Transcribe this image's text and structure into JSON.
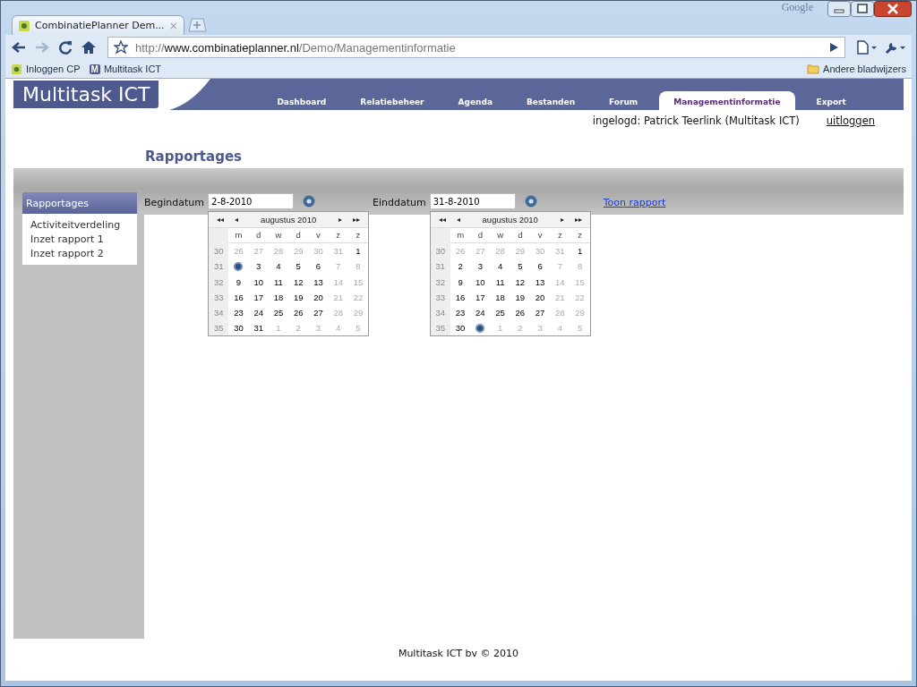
{
  "browser": {
    "tab_title": "CombinatiePlanner Dem...",
    "tab_close": "×",
    "brand": "Google",
    "url_prefix": "http://",
    "url_host": "www.combinatieplanner.nl",
    "url_path": "/Demo/Managementinformatie",
    "bookmarks": [
      {
        "label": "Inloggen CP",
        "kind": "cp"
      },
      {
        "label": "Multitask ICT",
        "kind": "m",
        "letter": "M"
      }
    ],
    "other_bookmarks": "Andere bladwijzers"
  },
  "site": {
    "logo": "Multitask ICT",
    "nav": [
      {
        "label": "Dashboard",
        "selected": false
      },
      {
        "label": "Relatiebeheer",
        "selected": false
      },
      {
        "label": "Agenda",
        "selected": false
      },
      {
        "label": "Bestanden",
        "selected": false
      },
      {
        "label": "Forum",
        "selected": false
      },
      {
        "label": "Managementinformatie",
        "selected": true
      },
      {
        "label": "Export",
        "selected": false
      }
    ],
    "login_text": "ingelogd: Patrick Teerlink (Multitask ICT)",
    "logout": "uitloggen",
    "page_title": "Rapportages"
  },
  "sidebar": {
    "title": "Rapportages",
    "items": [
      "Activiteitverdeling",
      "Inzet rapport 1",
      "Inzet rapport 2"
    ]
  },
  "filter": {
    "begin_label": "Begindatum",
    "begin_value": "2-8-2010",
    "end_label": "Einddatum",
    "end_value": "31-8-2010",
    "link": "Toon rapport"
  },
  "calendars": [
    {
      "nav": [
        "◂◂",
        "◂",
        "▸",
        "▸▸"
      ],
      "month": "augustus 2010",
      "weekdays": [
        "m",
        "d",
        "w",
        "d",
        "v",
        "z",
        "z"
      ],
      "weeks": [
        {
          "week": "30",
          "days": [
            {
              "label": "26",
              "muted": true,
              "selected": false
            },
            {
              "label": "27",
              "muted": true,
              "selected": false
            },
            {
              "label": "28",
              "muted": true,
              "selected": false
            },
            {
              "label": "29",
              "muted": true,
              "selected": false
            },
            {
              "label": "30",
              "muted": true,
              "selected": false
            },
            {
              "label": "31",
              "muted": true,
              "selected": false
            },
            {
              "label": "1",
              "muted": false,
              "selected": false
            }
          ]
        },
        {
          "week": "31",
          "days": [
            {
              "muted": false,
              "selected": true
            },
            {
              "label": "3",
              "muted": false,
              "selected": false
            },
            {
              "label": "4",
              "muted": false,
              "selected": false
            },
            {
              "label": "5",
              "muted": false,
              "selected": false
            },
            {
              "label": "6",
              "muted": false,
              "selected": false
            },
            {
              "label": "7",
              "muted": true,
              "selected": false
            },
            {
              "label": "8",
              "muted": true,
              "selected": false
            }
          ]
        },
        {
          "week": "32",
          "days": [
            {
              "label": "9",
              "muted": false,
              "selected": false
            },
            {
              "label": "10",
              "muted": false,
              "selected": false
            },
            {
              "label": "11",
              "muted": false,
              "selected": false
            },
            {
              "label": "12",
              "muted": false,
              "selected": false
            },
            {
              "label": "13",
              "muted": false,
              "selected": false
            },
            {
              "label": "14",
              "muted": true,
              "selected": false
            },
            {
              "label": "15",
              "muted": true,
              "selected": false
            }
          ]
        },
        {
          "week": "33",
          "days": [
            {
              "label": "16",
              "muted": false,
              "selected": false
            },
            {
              "label": "17",
              "muted": false,
              "selected": false
            },
            {
              "label": "18",
              "muted": false,
              "selected": false
            },
            {
              "label": "19",
              "muted": false,
              "selected": false
            },
            {
              "label": "20",
              "muted": false,
              "selected": false
            },
            {
              "label": "21",
              "muted": true,
              "selected": false
            },
            {
              "label": "22",
              "muted": true,
              "selected": false
            }
          ]
        },
        {
          "week": "34",
          "days": [
            {
              "label": "23",
              "muted": false,
              "selected": false
            },
            {
              "label": "24",
              "muted": false,
              "selected": false
            },
            {
              "label": "25",
              "muted": false,
              "selected": false
            },
            {
              "label": "26",
              "muted": false,
              "selected": false
            },
            {
              "label": "27",
              "muted": false,
              "selected": false
            },
            {
              "label": "28",
              "muted": true,
              "selected": false
            },
            {
              "label": "29",
              "muted": true,
              "selected": false
            }
          ]
        },
        {
          "week": "35",
          "days": [
            {
              "label": "30",
              "muted": false,
              "selected": false
            },
            {
              "label": "31",
              "muted": false,
              "selected": false
            },
            {
              "label": "1",
              "muted": true,
              "selected": false
            },
            {
              "label": "2",
              "muted": true,
              "selected": false
            },
            {
              "label": "3",
              "muted": true,
              "selected": false
            },
            {
              "label": "4",
              "muted": true,
              "selected": false
            },
            {
              "label": "5",
              "muted": true,
              "selected": false
            }
          ]
        }
      ]
    },
    {
      "nav": [
        "◂◂",
        "◂",
        "▸",
        "▸▸"
      ],
      "month": "augustus 2010",
      "weekdays": [
        "m",
        "d",
        "w",
        "d",
        "v",
        "z",
        "z"
      ],
      "weeks": [
        {
          "week": "30",
          "days": [
            {
              "label": "26",
              "muted": true,
              "selected": false
            },
            {
              "label": "27",
              "muted": true,
              "selected": false
            },
            {
              "label": "28",
              "muted": true,
              "selected": false
            },
            {
              "label": "29",
              "muted": true,
              "selected": false
            },
            {
              "label": "30",
              "muted": true,
              "selected": false
            },
            {
              "label": "31",
              "muted": true,
              "selected": false
            },
            {
              "label": "1",
              "muted": false,
              "selected": false
            }
          ]
        },
        {
          "week": "31",
          "days": [
            {
              "label": "2",
              "muted": false,
              "selected": false
            },
            {
              "label": "3",
              "muted": false,
              "selected": false
            },
            {
              "label": "4",
              "muted": false,
              "selected": false
            },
            {
              "label": "5",
              "muted": false,
              "selected": false
            },
            {
              "label": "6",
              "muted": false,
              "selected": false
            },
            {
              "label": "7",
              "muted": true,
              "selected": false
            },
            {
              "label": "8",
              "muted": true,
              "selected": false
            }
          ]
        },
        {
          "week": "32",
          "days": [
            {
              "label": "9",
              "muted": false,
              "selected": false
            },
            {
              "label": "10",
              "muted": false,
              "selected": false
            },
            {
              "label": "11",
              "muted": false,
              "selected": false
            },
            {
              "label": "12",
              "muted": false,
              "selected": false
            },
            {
              "label": "13",
              "muted": false,
              "selected": false
            },
            {
              "label": "14",
              "muted": true,
              "selected": false
            },
            {
              "label": "15",
              "muted": true,
              "selected": false
            }
          ]
        },
        {
          "week": "33",
          "days": [
            {
              "label": "16",
              "muted": false,
              "selected": false
            },
            {
              "label": "17",
              "muted": false,
              "selected": false
            },
            {
              "label": "18",
              "muted": false,
              "selected": false
            },
            {
              "label": "19",
              "muted": false,
              "selected": false
            },
            {
              "label": "20",
              "muted": false,
              "selected": false
            },
            {
              "label": "21",
              "muted": true,
              "selected": false
            },
            {
              "label": "22",
              "muted": true,
              "selected": false
            }
          ]
        },
        {
          "week": "34",
          "days": [
            {
              "label": "23",
              "muted": false,
              "selected": false
            },
            {
              "label": "24",
              "muted": false,
              "selected": false
            },
            {
              "label": "25",
              "muted": false,
              "selected": false
            },
            {
              "label": "26",
              "muted": false,
              "selected": false
            },
            {
              "label": "27",
              "muted": false,
              "selected": false
            },
            {
              "label": "28",
              "muted": true,
              "selected": false
            },
            {
              "label": "29",
              "muted": true,
              "selected": false
            }
          ]
        },
        {
          "week": "35",
          "days": [
            {
              "label": "30",
              "muted": false,
              "selected": false
            },
            {
              "muted": false,
              "selected": true
            },
            {
              "label": "1",
              "muted": true,
              "selected": false
            },
            {
              "label": "2",
              "muted": true,
              "selected": false
            },
            {
              "label": "3",
              "muted": true,
              "selected": false
            },
            {
              "label": "4",
              "muted": true,
              "selected": false
            },
            {
              "label": "5",
              "muted": true,
              "selected": false
            }
          ]
        }
      ]
    }
  ],
  "footer": "Multitask ICT bv © 2010"
}
